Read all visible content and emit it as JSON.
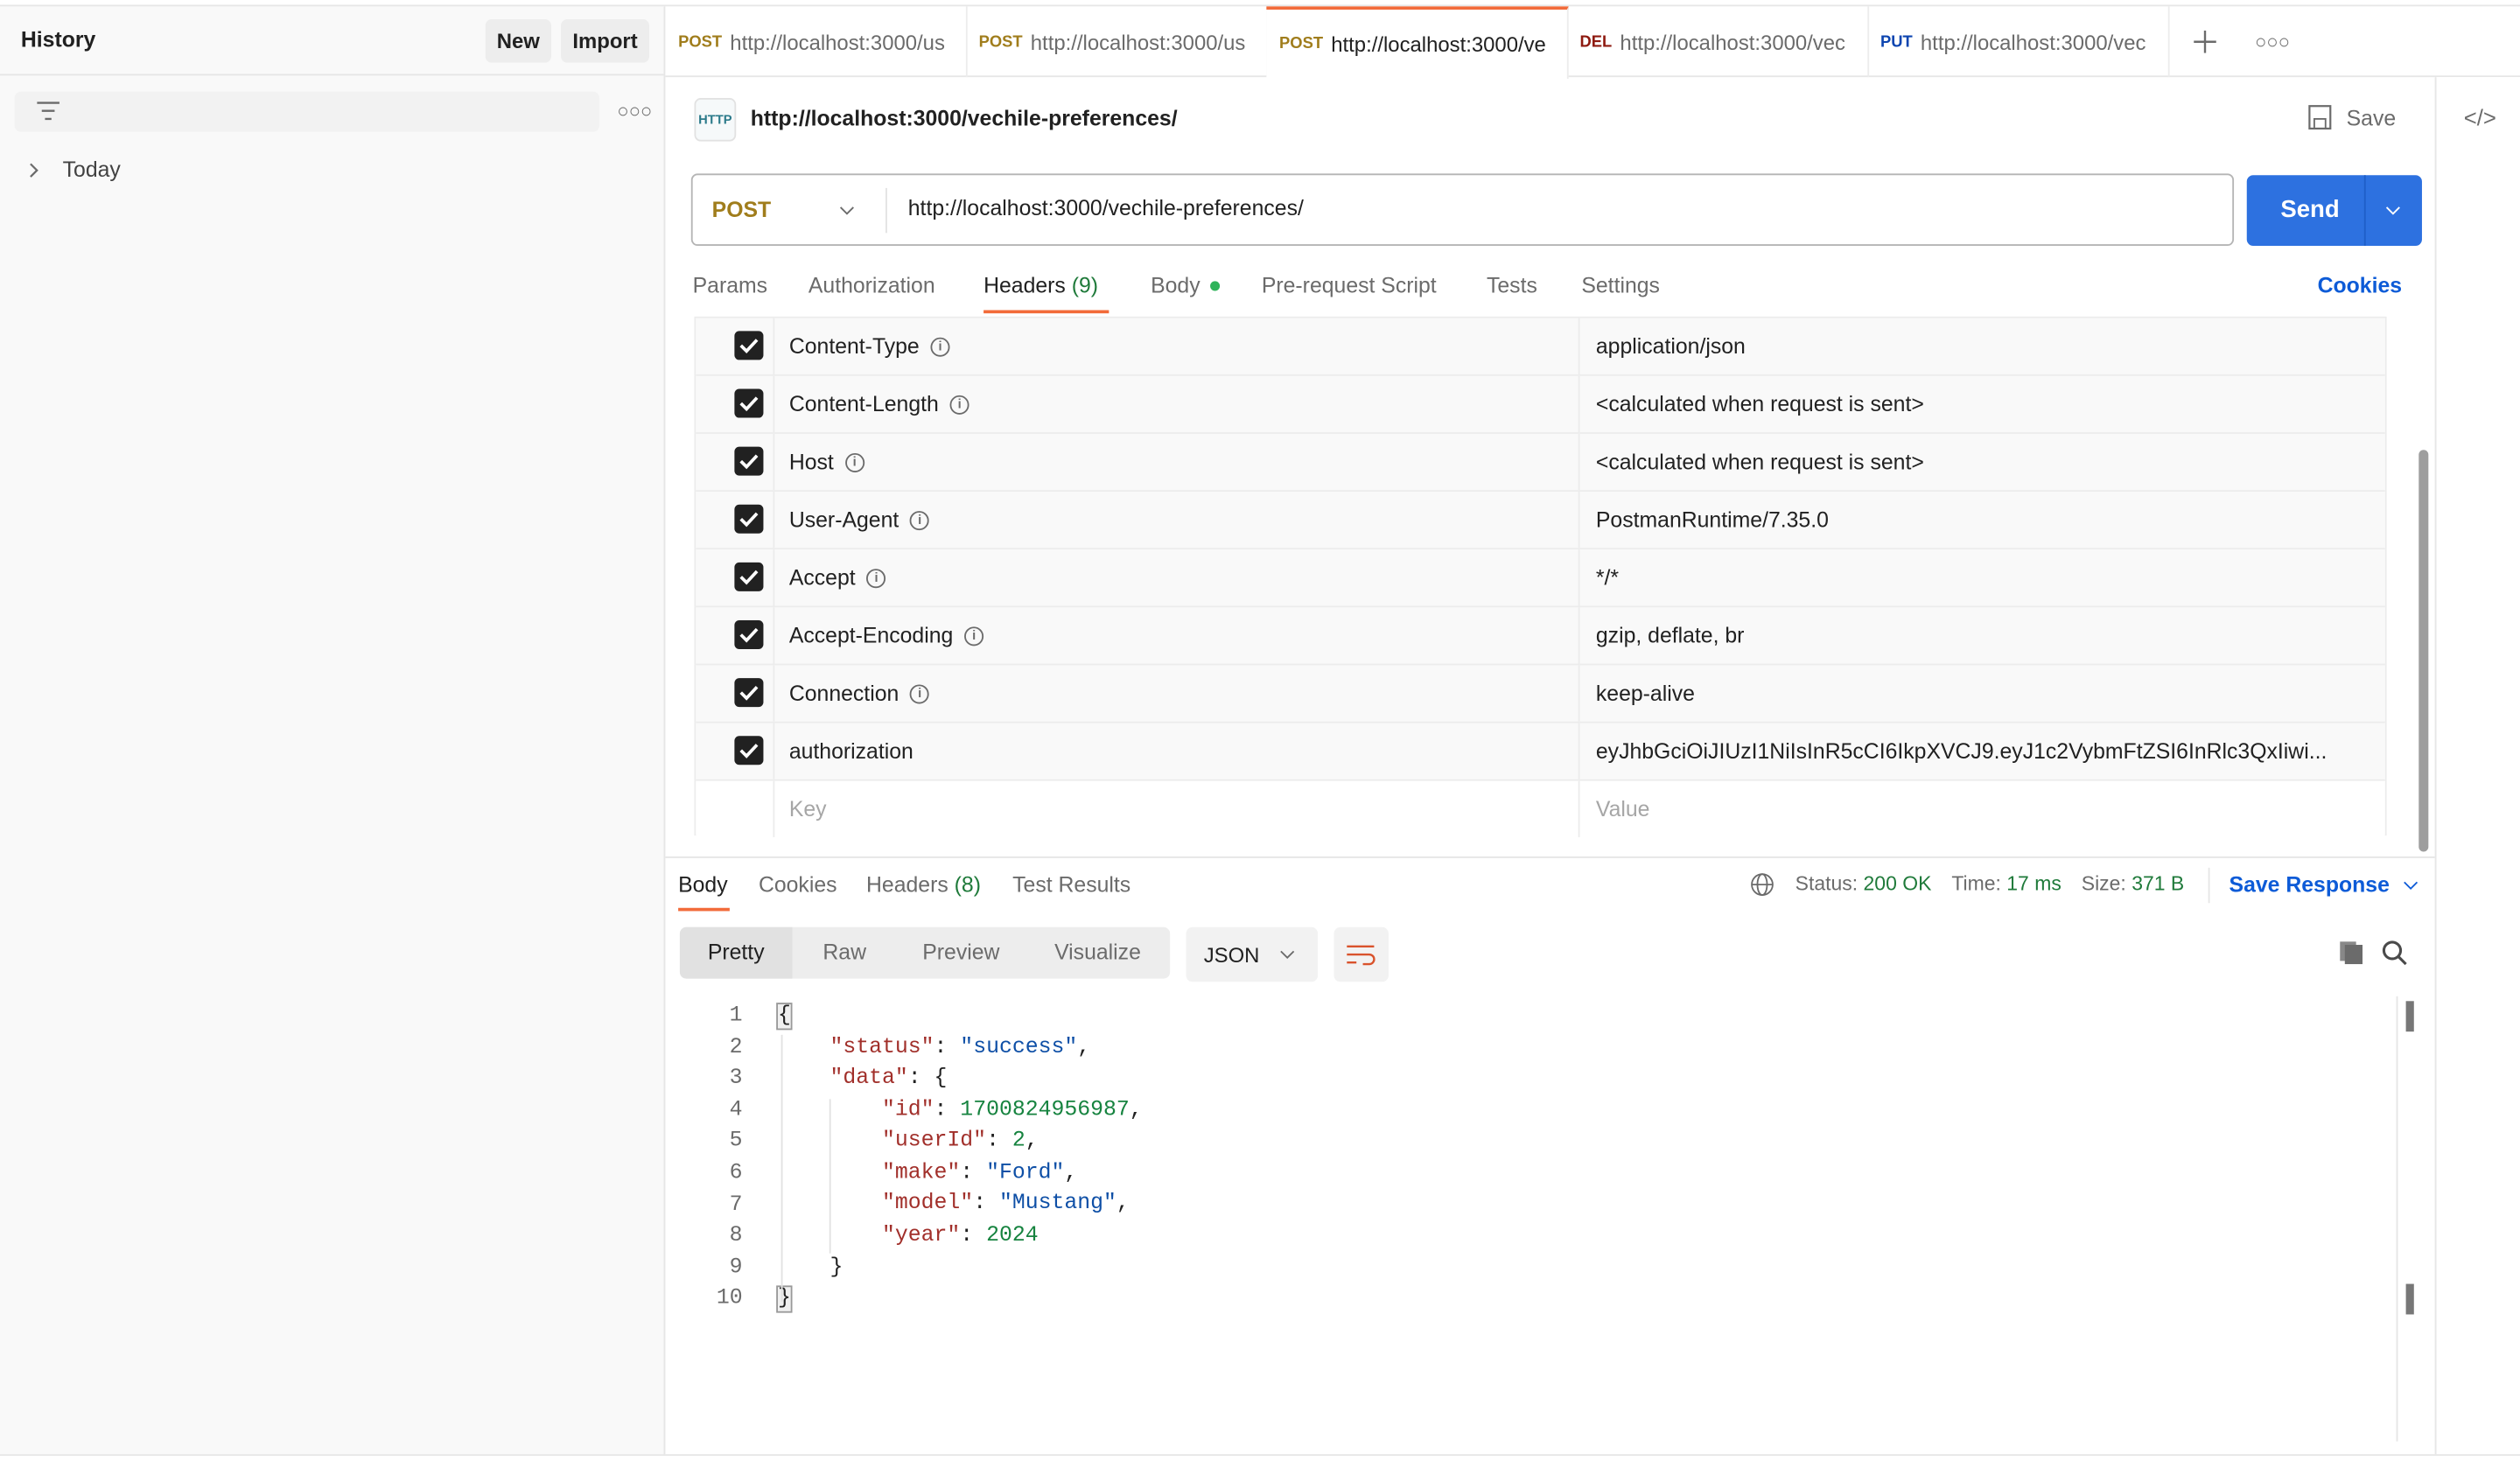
{
  "sidebar": {
    "title": "History",
    "new_label": "New",
    "import_label": "Import",
    "groups": [
      {
        "label": "Today"
      }
    ]
  },
  "tabs": [
    {
      "method": "POST",
      "url": "http://localhost:3000/us",
      "active": false
    },
    {
      "method": "POST",
      "url": "http://localhost:3000/us",
      "active": false
    },
    {
      "method": "POST",
      "url": "http://localhost:3000/ve",
      "active": true
    },
    {
      "method": "DEL",
      "url": "http://localhost:3000/vec",
      "active": false
    },
    {
      "method": "PUT",
      "url": "http://localhost:3000/vec",
      "active": false
    }
  ],
  "request": {
    "title": "http://localhost:3000/vechile-preferences/",
    "save_label": "Save",
    "method": "POST",
    "url": "http://localhost:3000/vechile-preferences/",
    "send_label": "Send"
  },
  "request_tabs": [
    {
      "label": "Params"
    },
    {
      "label": "Authorization"
    },
    {
      "label": "Headers",
      "count": "(9)"
    },
    {
      "label": "Body"
    },
    {
      "label": "Pre-request Script"
    },
    {
      "label": "Tests"
    },
    {
      "label": "Settings"
    }
  ],
  "cookies_label": "Cookies",
  "headers": [
    {
      "key": "Content-Type",
      "value": "application/json",
      "info": true
    },
    {
      "key": "Content-Length",
      "value": "<calculated when request is sent>",
      "info": true
    },
    {
      "key": "Host",
      "value": "<calculated when request is sent>",
      "info": true
    },
    {
      "key": "User-Agent",
      "value": "PostmanRuntime/7.35.0",
      "info": true
    },
    {
      "key": "Accept",
      "value": "*/*",
      "info": true
    },
    {
      "key": "Accept-Encoding",
      "value": "gzip, deflate, br",
      "info": true
    },
    {
      "key": "Connection",
      "value": "keep-alive",
      "info": true
    },
    {
      "key": "authorization",
      "value": "eyJhbGciOiJIUzI1NiIsInR5cCI6IkpXVCJ9.eyJ1c2VybmFtZSI6InRlc3QxIiwi...",
      "info": false
    }
  ],
  "headers_placeholder": {
    "key": "Key",
    "value": "Value"
  },
  "response": {
    "tabs": [
      {
        "label": "Body"
      },
      {
        "label": "Cookies"
      },
      {
        "label": "Headers",
        "count": "(8)"
      },
      {
        "label": "Test Results"
      }
    ],
    "status_label": "Status:",
    "status": "200 OK",
    "time_label": "Time:",
    "time": "17 ms",
    "size_label": "Size:",
    "size": "371 B",
    "save_label": "Save Response",
    "views": [
      "Pretty",
      "Raw",
      "Preview",
      "Visualize"
    ],
    "format": "JSON",
    "lines": [
      "1",
      "2",
      "3",
      "4",
      "5",
      "6",
      "7",
      "8",
      "9",
      "10"
    ]
  },
  "body_json": {
    "status": "success",
    "id": "1700824956987",
    "userId": "2",
    "make": "Ford",
    "model": "Mustang",
    "year": "2024"
  },
  "colors": {
    "accent": "#f26b3a",
    "send": "#2d71e0",
    "success": "#1f7a3a",
    "link": "#0d5bd7"
  }
}
